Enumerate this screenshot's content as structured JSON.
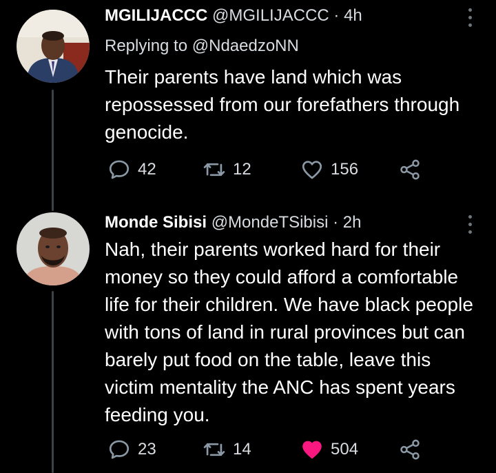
{
  "tweets": [
    {
      "name": "MGILIJACCC",
      "handle": "@MGILIJACCC",
      "separator": "·",
      "time": "4h",
      "replying_prefix": "Replying to",
      "replying_to": "@NdaedzoNN",
      "text": "Their parents have land which was repossessed from our forefathers through genocide.",
      "replies": "42",
      "retweets": "12",
      "likes": "156",
      "liked": false,
      "reply_icon": "speech-bubble-icon",
      "retweet_icon": "retweet-arrows-icon",
      "like_icon": "heart-outline-icon",
      "share_icon": "share-nodes-icon"
    },
    {
      "name": "Monde Sibisi",
      "handle": "@MondeTSibisi",
      "separator": "·",
      "time": "2h",
      "text": "Nah, their parents worked hard for their money so they could afford a comfortable life for their children. We have black people with tons of land in rural provinces but can barely put food on the table, leave this victim mentality the ANC has spent years feeding you.",
      "replies": "23",
      "retweets": "14",
      "likes": "504",
      "liked": true,
      "reply_icon": "speech-bubble-icon",
      "retweet_icon": "retweet-arrows-icon",
      "like_icon": "heart-filled-icon",
      "share_icon": "share-nodes-icon"
    }
  ],
  "colors": {
    "background": "#000000",
    "text": "#ffffff",
    "secondary": "#d9dde1",
    "icon": "#8b98a5",
    "like_active": "#f91880",
    "thread_line": "#3d4247"
  }
}
